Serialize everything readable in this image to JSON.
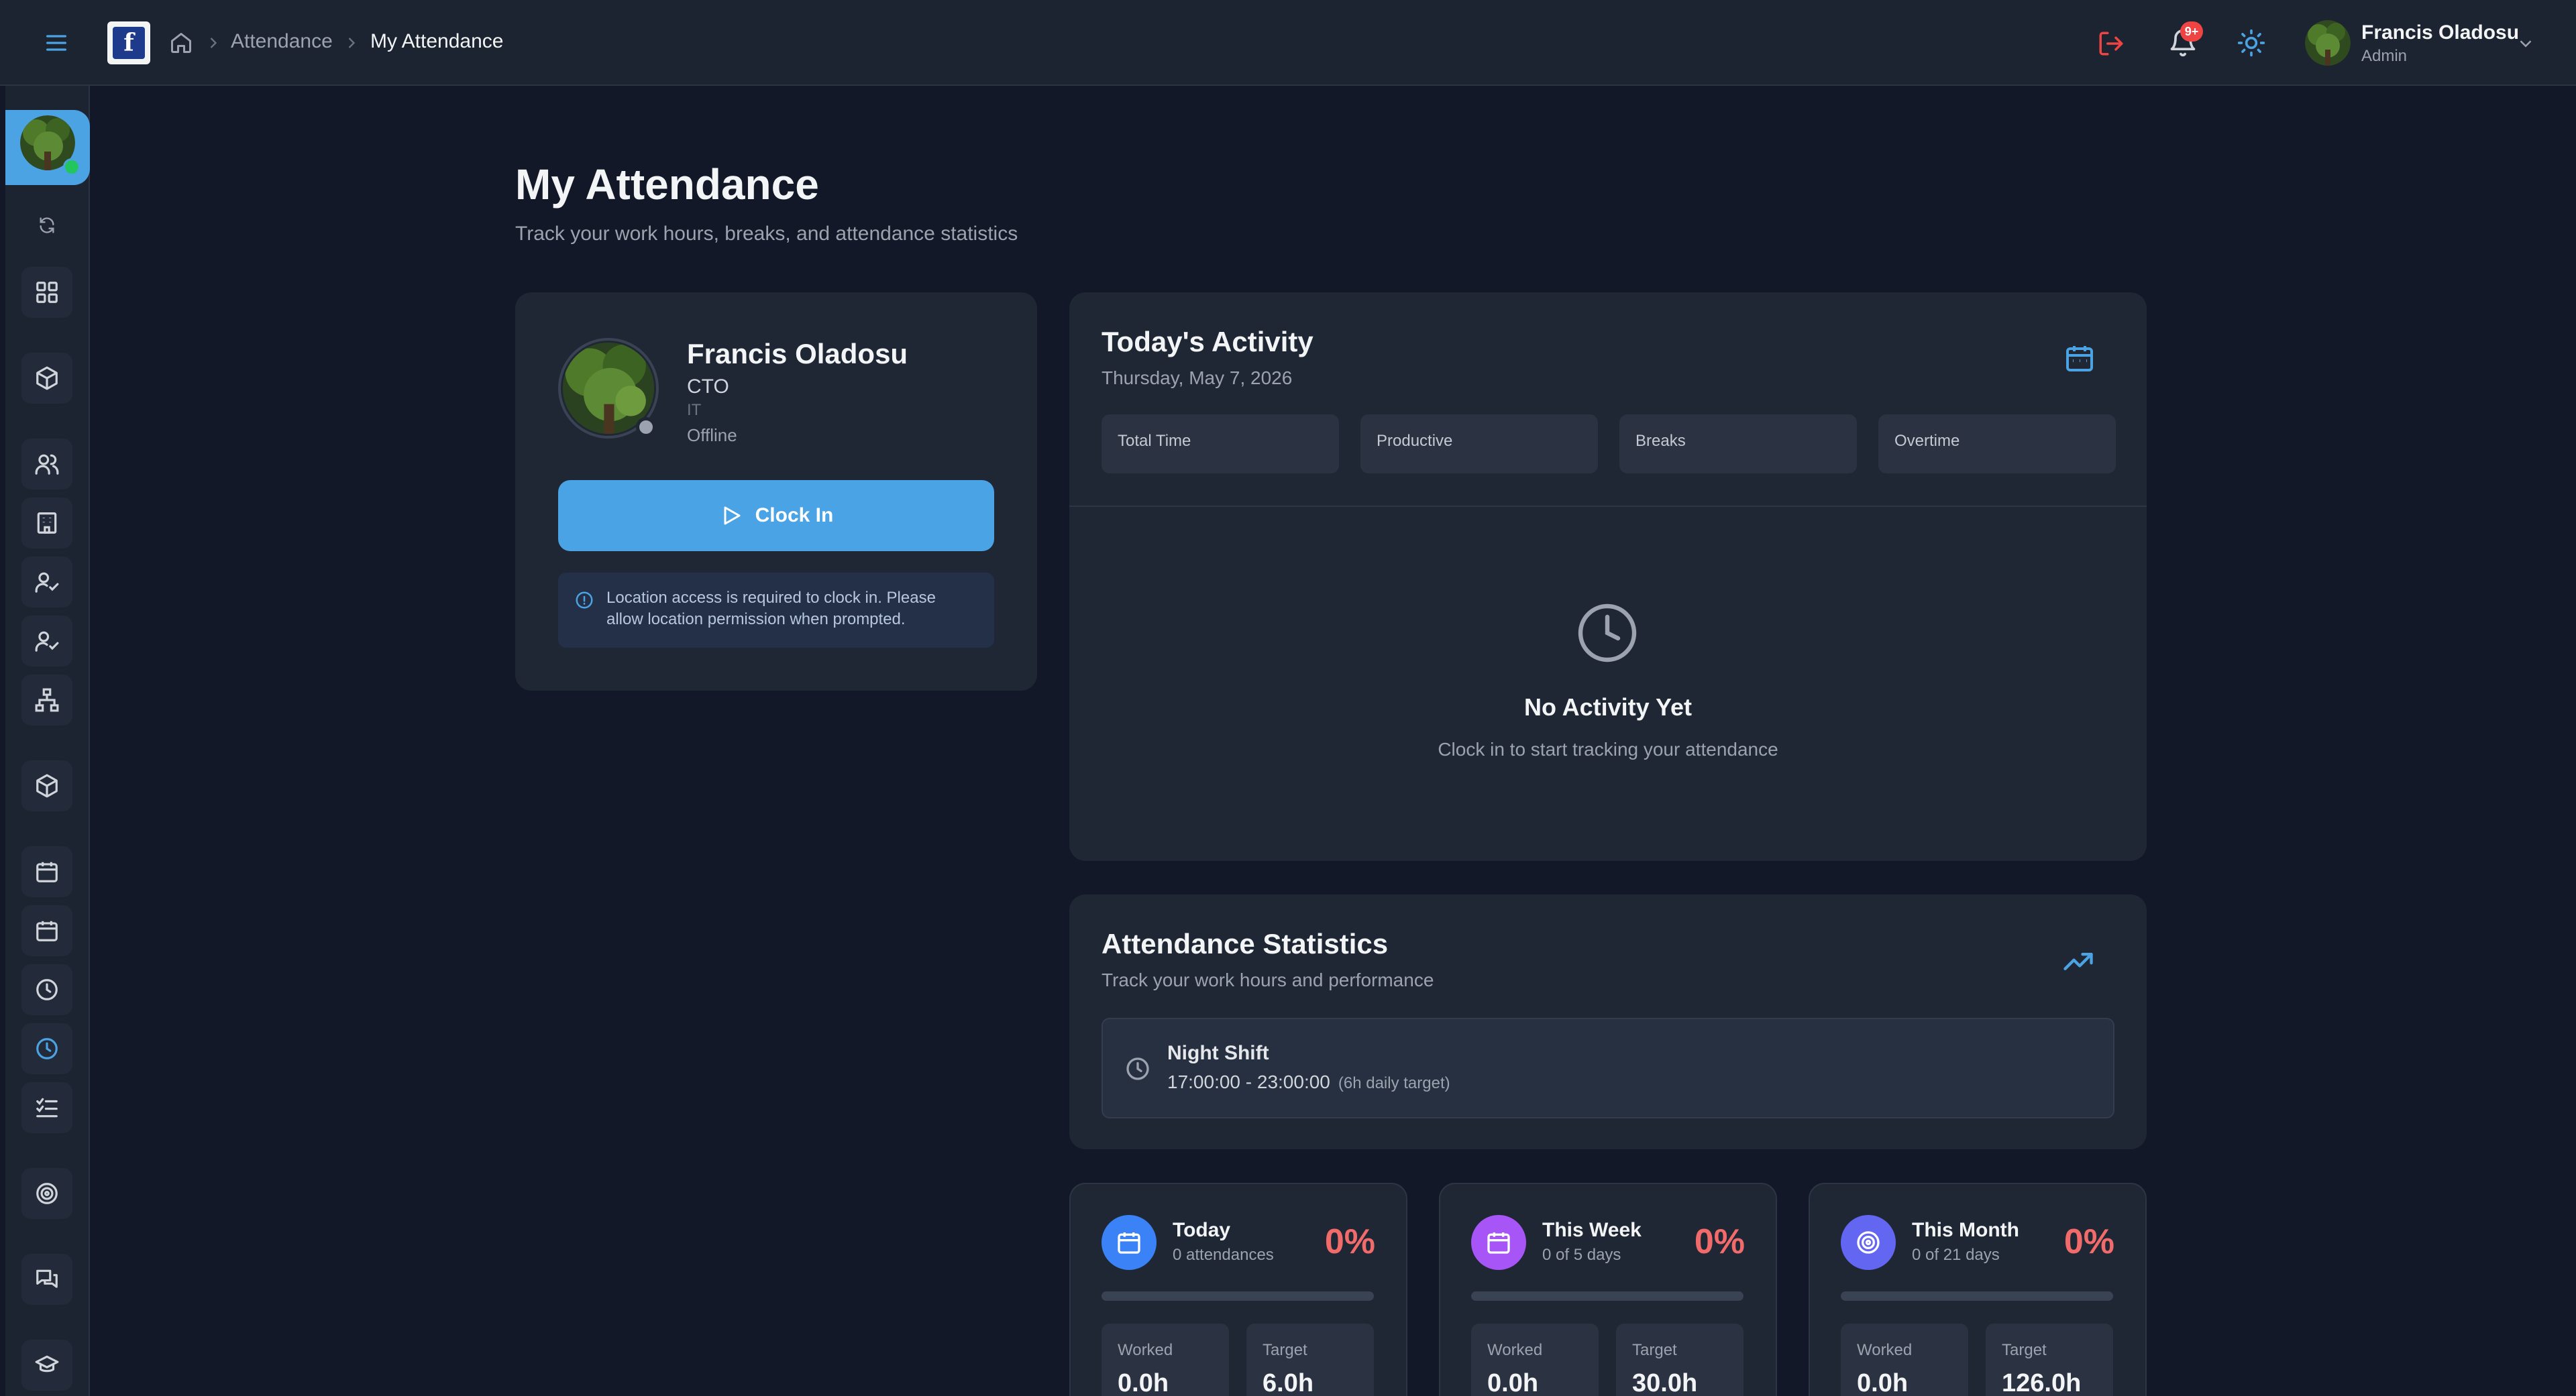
{
  "header": {
    "logo_letter": "f",
    "breadcrumb": [
      "Attendance",
      "My Attendance"
    ],
    "notification_badge": "9+",
    "user": {
      "name": "Francis Oladosu",
      "role": "Admin"
    }
  },
  "sidebar": {
    "items": [
      "refresh-icon",
      "dashboard-icon",
      "cube-icon",
      "users-icon",
      "building-icon",
      "user-check-icon",
      "user-check-icon",
      "org-chart-icon",
      "cube-icon",
      "calendar-icon",
      "calendar-icon",
      "clock-icon",
      "clock-icon",
      "checklist-icon",
      "target-icon",
      "chat-icon",
      "graduation-cap-icon"
    ],
    "active": "clock-icon"
  },
  "page": {
    "title": "My Attendance",
    "subtitle": "Track your work hours, breaks, and attendance statistics"
  },
  "profile": {
    "name": "Francis Oladosu",
    "title": "CTO",
    "department": "IT",
    "status": "Offline",
    "clock_in_label": "Clock In",
    "location_note": "Location access is required to clock in. Please allow location permission when prompted."
  },
  "activity": {
    "title": "Today's Activity",
    "date": "Thursday, May 7, 2026",
    "stats": [
      "Total Time",
      "Productive",
      "Breaks",
      "Overtime"
    ],
    "empty_title": "No Activity Yet",
    "empty_subtitle": "Clock in to start tracking your attendance"
  },
  "statistics": {
    "title": "Attendance Statistics",
    "subtitle": "Track your work hours and performance",
    "shift": {
      "name": "Night Shift",
      "time": "17:00:00 - 23:00:00",
      "target": "(6h daily target)"
    }
  },
  "summary": [
    {
      "title": "Today",
      "subtitle": "0 attendances",
      "percent": "0%",
      "progress": 0,
      "worked_label": "Worked",
      "worked": "0.0h",
      "target_label": "Target",
      "target": "6.0h",
      "icon_color": "#3b82f6"
    },
    {
      "title": "This Week",
      "subtitle": "0 of 5 days",
      "percent": "0%",
      "progress": 0,
      "worked_label": "Worked",
      "worked": "0.0h",
      "target_label": "Target",
      "target": "30.0h",
      "icon_color": "#a855f7"
    },
    {
      "title": "This Month",
      "subtitle": "0 of 21 days",
      "percent": "0%",
      "progress": 0,
      "worked_label": "Worked",
      "worked": "0.0h",
      "target_label": "Target",
      "target": "126.0h",
      "icon_color": "#6366f1"
    }
  ],
  "colors": {
    "accent": "#49a3e5",
    "danger": "#f26b6b",
    "background": "#121827",
    "panel": "#1f2735"
  }
}
